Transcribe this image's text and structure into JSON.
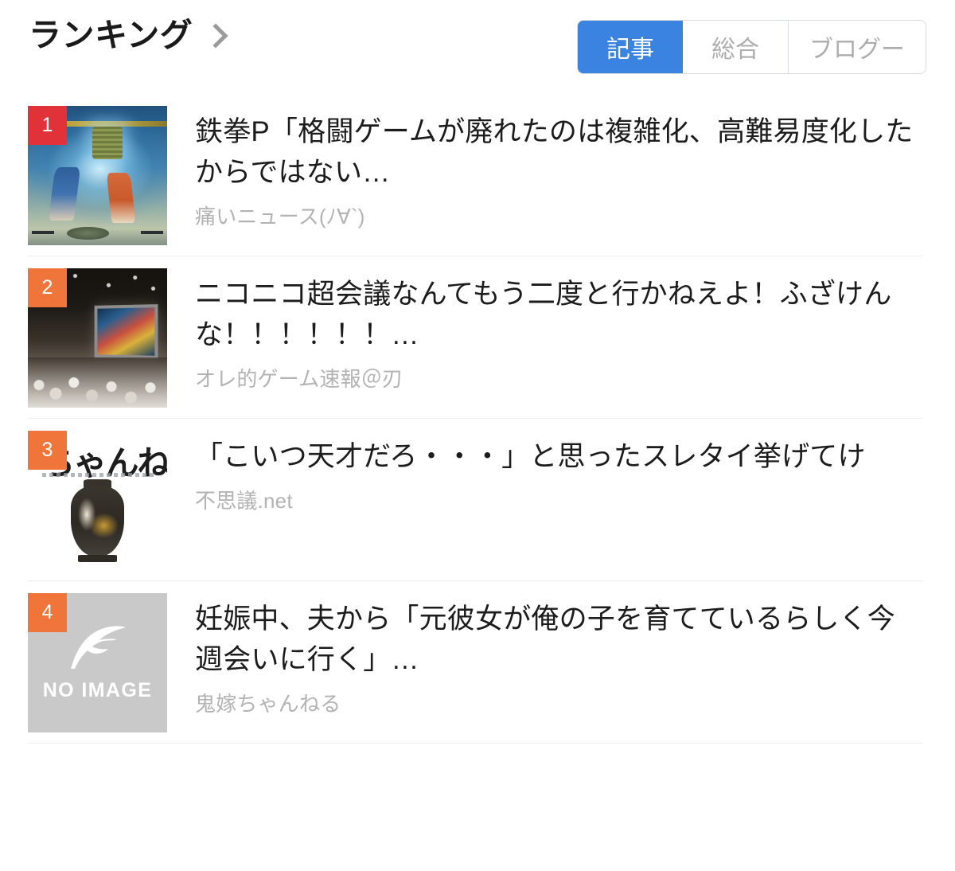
{
  "header": {
    "title": "ランキング",
    "chevron_icon": "chevron-right-icon",
    "tabs": [
      {
        "label": "記事",
        "active": true
      },
      {
        "label": "総合",
        "active": false
      },
      {
        "label": "ブログー",
        "active": false
      }
    ],
    "active_tab_color": "#3b83e0",
    "inactive_tab_text_color": "#adadad"
  },
  "ranking": {
    "items": [
      {
        "rank": "1",
        "badge_color": "#e1323a",
        "title": "鉄拳P「格闘ゲームが廃れたのは複雑化、高難易度化したからではない…",
        "source": "痛いニュース(ﾉ∀`)",
        "thumbnail": "fighting-game-screenshot"
      },
      {
        "rank": "2",
        "badge_color": "#f0753a",
        "title": "ニコニコ超会議なんてもう二度と行かねえよ！ふざけんな！！！！！！…",
        "source": "オレ的ゲーム速報＠刃",
        "thumbnail": "convention-hall-photo"
      },
      {
        "rank": "3",
        "badge_color": "#f0753a",
        "title": "「こいつ天才だろ・・・」と思ったスレタイ挙げてけ",
        "source": "不思議.net",
        "thumbnail": "blog-logo-vase",
        "thumbnail_logo_text": "ちゃんね"
      },
      {
        "rank": "4",
        "badge_color": "#f0753a",
        "title": "妊娠中、夫から「元彼女が俺の子を育てているらしく今週会いに行く」…",
        "source": "鬼嫁ちゃんねる",
        "thumbnail": "no-image-placeholder",
        "thumbnail_placeholder_label": "NO IMAGE",
        "thumbnail_placeholder_icon": "feather-icon"
      }
    ]
  },
  "colors": {
    "divider": "#eceef0",
    "title_text": "#1c1c1c",
    "source_text": "#b3b3b3",
    "background": "#ffffff"
  }
}
